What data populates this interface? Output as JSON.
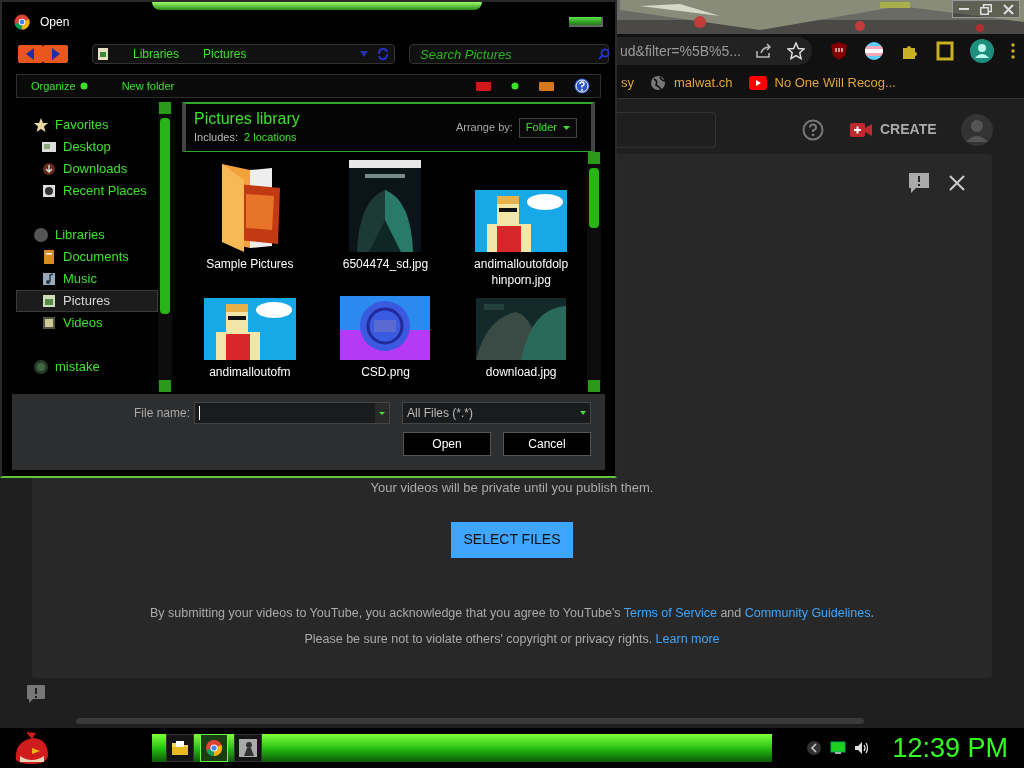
{
  "dialog": {
    "title": "Open",
    "breadcrumb": [
      "Libraries",
      "Pictures"
    ],
    "search": {
      "placeholder": "Search Pictures"
    },
    "toolbar": [
      "Organize",
      "New folder"
    ],
    "nav": [
      {
        "label": "Favorites",
        "kind": "star",
        "selected": false,
        "children": [
          {
            "label": "Desktop",
            "kind": "desktop",
            "selected": false
          },
          {
            "label": "Downloads",
            "kind": "downloads",
            "selected": false
          },
          {
            "label": "Recent Places",
            "kind": "recent",
            "selected": false
          }
        ]
      },
      {
        "label": "Libraries",
        "kind": "library",
        "selected": false,
        "children": [
          {
            "label": "Documents",
            "kind": "documents",
            "selected": false
          },
          {
            "label": "Music",
            "kind": "music",
            "selected": false
          },
          {
            "label": "Pictures",
            "kind": "pictures",
            "selected": true
          },
          {
            "label": "Videos",
            "kind": "videos",
            "selected": false
          }
        ]
      },
      {
        "label": "mistake",
        "kind": "homegroup",
        "selected": false
      }
    ],
    "library": {
      "title": "Pictures library",
      "includes_label": "Includes:",
      "includes_link": "2 locations",
      "arrange_label": "Arrange by:",
      "arrange_value": "Folder"
    },
    "files": [
      {
        "name": "Sample Pictures",
        "kind": "folder"
      },
      {
        "name": "6504474_sd.jpg",
        "kind": "poster"
      },
      {
        "name": "andimalloutofdolphinporn.jpg",
        "kind": "cartoon"
      },
      {
        "name": "andimalloutofm",
        "kind": "cartoon"
      },
      {
        "name": "CSD.png",
        "kind": "badge"
      },
      {
        "name": "download.jpg"
      }
    ],
    "file_name_label": "File name:",
    "file_type": "All Files (*.*)",
    "buttons": [
      "Open",
      "Cancel"
    ]
  },
  "browser": {
    "url": "ud&filter=%5B%5...",
    "bookmarks": [
      {
        "label": "sy",
        "kind": "text"
      },
      {
        "label": "malwat.ch",
        "kind": "globe"
      },
      {
        "label": "No One Will Recog...",
        "kind": "video"
      }
    ]
  },
  "studio": {
    "create": "CREATE",
    "notice": "Your videos will be private until you publish them.",
    "select_button": "SELECT FILES",
    "legal": [
      [
        {
          "text": "By submitting your videos to YouTube, you acknowledge that you agree to YouTube's ",
          "kind": "text"
        },
        {
          "text": "Terms of Service",
          "kind": "link"
        },
        {
          "text": " and ",
          "kind": "text"
        },
        {
          "text": "Community Guidelines",
          "kind": "link"
        },
        {
          "text": ".",
          "kind": "text"
        }
      ],
      [
        {
          "text": "Please be sure not to violate others' copyright or privacy rights. ",
          "kind": "text"
        },
        {
          "text": "Learn more",
          "kind": "link"
        }
      ]
    ]
  },
  "taskbar": {
    "time": "12:39 PM",
    "apps": [
      {
        "kind": "folder",
        "selected": false
      },
      {
        "kind": "browser",
        "selected": true
      },
      {
        "kind": "figure",
        "selected": false
      }
    ]
  }
}
